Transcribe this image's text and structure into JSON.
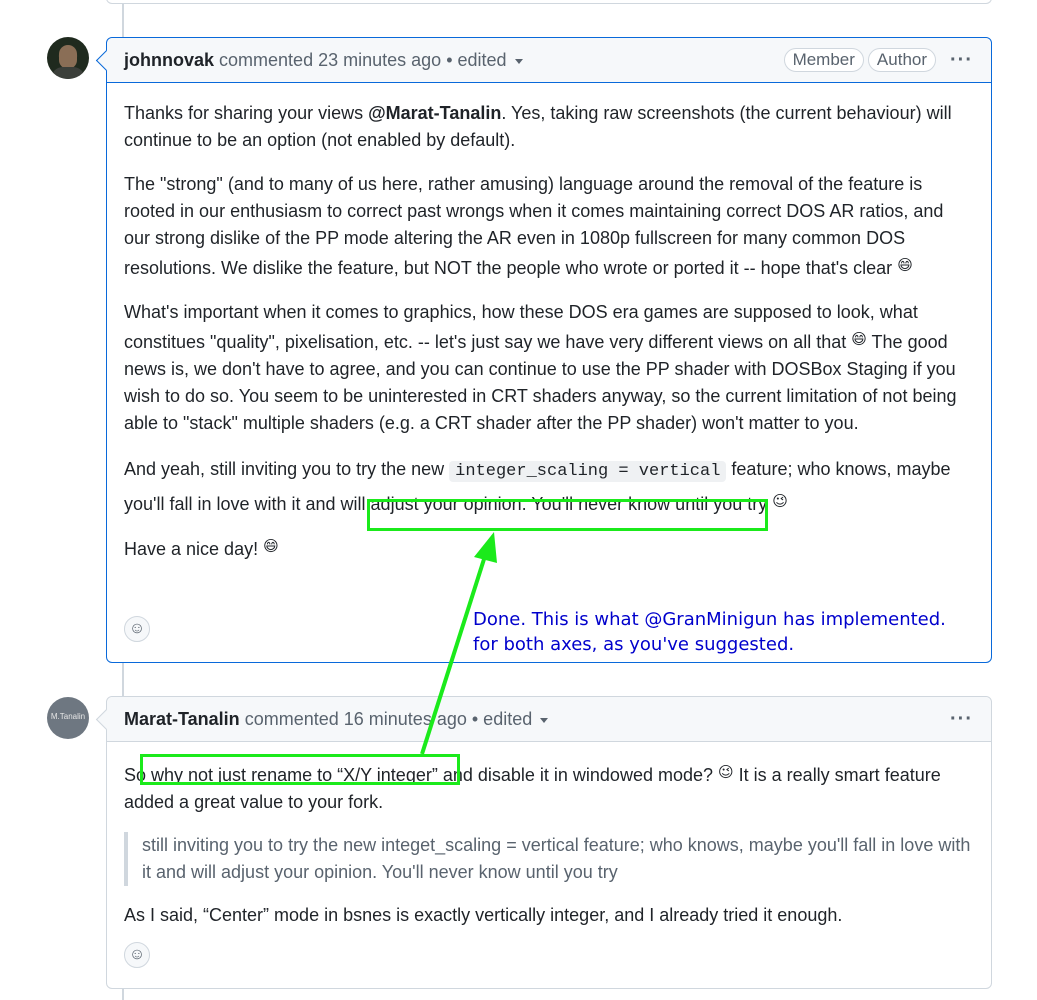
{
  "comment1": {
    "author": "johnnovak",
    "action": "commented",
    "time": "23 minutes ago",
    "edited": "• edited",
    "badges": [
      "Member",
      "Author"
    ],
    "p1_a": "Thanks for sharing your views ",
    "p1_mention": "@Marat-Tanalin",
    "p1_b": ". Yes, taking raw screenshots (the current behaviour) will continue to be an option (not enabled by default).",
    "p2": "The \"strong\" (and to many of us here, rather amusing) language around the removal of the feature is rooted in our enthusiasm to correct past wrongs when it comes maintaining correct DOS AR ratios, and our strong dislike of the PP mode altering the AR even in 1080p fullscreen for many common DOS resolutions. We dislike the feature, but NOT the people who wrote or ported it -- hope that's clear",
    "p3_a": "What's important when it comes to graphics, how these DOS era games are supposed to look, what constitues \"quality\", pixelisation, etc. -- let's just say we have very different views on all that",
    "p3_b": " The good news is, we don't have to agree, and you can continue to use the PP shader with DOSBox Staging if you wish to do so. You seem to be uninterested in CRT shaders anyway, so the current limitation of not being able to \"stack\" multiple shaders (e.g. a CRT shader after the PP shader) won't matter to you.",
    "p4_a": "And yeah, still inviting you to try the new ",
    "p4_code": "integer_scaling = vertical",
    "p4_b": " feature; who knows, maybe you'll fall in love with it and will adjust your opinion. You'll never know until you try",
    "p5": "Have a nice day!",
    "emoji_grin": "😄",
    "emoji_wink": "😉"
  },
  "comment2": {
    "author": "Marat-Tanalin",
    "avatar_text": "M.Tanalin",
    "action": "commented",
    "time": "16 minutes ago",
    "edited": "• edited",
    "p1_a": "So why not just rename to “X/Y integer” and disable it in windowed mode?",
    "p1_b": " It is a really smart feature added a great value to your fork.",
    "quote": "still inviting you to try the new integet_scaling = vertical feature; who knows, maybe you'll fall in love with it and will adjust your opinion. You'll never know until you try",
    "p2": "As I said, “Center” mode in bsnes is exactly vertically integer, and I already tried it enough.",
    "emoji_wink": "😉"
  },
  "annotation": {
    "line1": "Done. This is what @GranMinigun has implemented.",
    "line2": "for both axes, as you've suggested.",
    "color": "#0000cc",
    "highlight_color": "#1bea1b"
  },
  "icons": {
    "kebab": "···",
    "smiley": "☺"
  }
}
